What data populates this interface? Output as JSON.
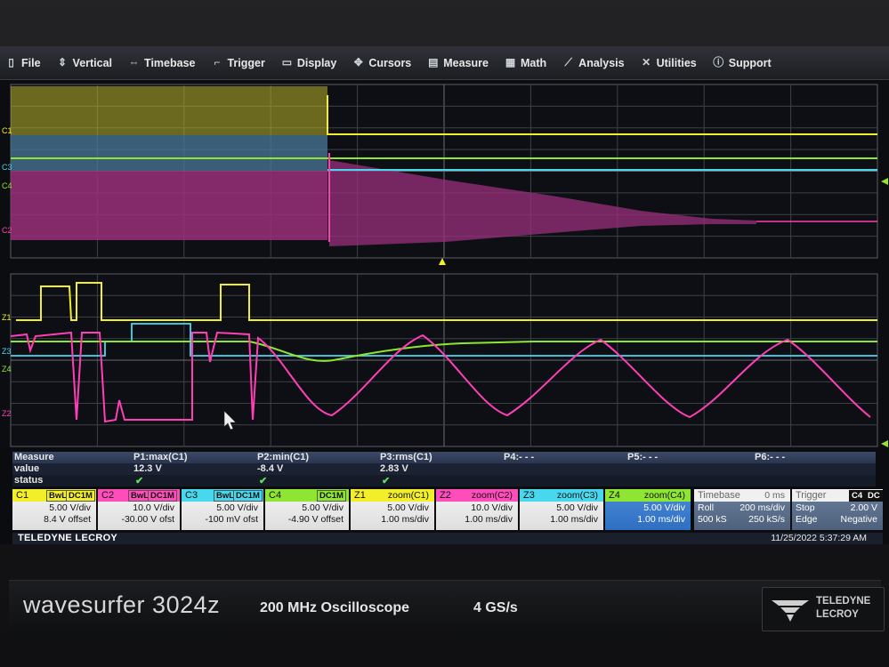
{
  "menu": [
    {
      "label": "File",
      "icon": "file-icon"
    },
    {
      "label": "Vertical",
      "icon": "vertical-icon"
    },
    {
      "label": "Timebase",
      "icon": "timebase-icon"
    },
    {
      "label": "Trigger",
      "icon": "trigger-icon"
    },
    {
      "label": "Display",
      "icon": "display-icon"
    },
    {
      "label": "Cursors",
      "icon": "cursors-icon"
    },
    {
      "label": "Measure",
      "icon": "measure-icon"
    },
    {
      "label": "Math",
      "icon": "math-icon"
    },
    {
      "label": "Analysis",
      "icon": "analysis-icon"
    },
    {
      "label": "Utilities",
      "icon": "utilities-icon"
    },
    {
      "label": "Support",
      "icon": "support-icon"
    }
  ],
  "upper_grid": {
    "labels": {
      "c1": "C1",
      "c3": "C3",
      "c4": "C4",
      "c2": "C2"
    }
  },
  "lower_grid": {
    "labels": {
      "z1": "Z1",
      "z3": "Z3",
      "z4": "Z4",
      "z2": "Z2"
    }
  },
  "measure": {
    "header_label": "Measure",
    "value_label": "value",
    "status_label": "status",
    "p1_name": "P1:max(C1)",
    "p2_name": "P2:min(C1)",
    "p3_name": "P3:rms(C1)",
    "p4_name": "P4:- - -",
    "p5_name": "P5:- - -",
    "p6_name": "P6:- - -",
    "p1_value": "12.3 V",
    "p2_value": "-8.4 V",
    "p3_value": "2.83 V",
    "status_check": "✔"
  },
  "channels": {
    "c1": {
      "label": "C1",
      "bwl": "BwL",
      "coupling": "DC1M",
      "scale": "5.00 V/div",
      "offset": "8.4 V offset"
    },
    "c2": {
      "label": "C2",
      "bwl": "BwL",
      "coupling": "DC1M",
      "scale": "10.0 V/div",
      "offset": "-30.00 V ofst"
    },
    "c3": {
      "label": "C3",
      "bwl": "BwL",
      "coupling": "DC1M",
      "scale": "5.00 V/div",
      "offset": "-100 mV ofst"
    },
    "c4": {
      "label": "C4",
      "coupling": "DC1M",
      "scale": "5.00 V/div",
      "offset": "-4.90 V offset"
    },
    "z1": {
      "label": "Z1",
      "source": "zoom(C1)",
      "scale": "5.00 V/div",
      "time": "1.00 ms/div"
    },
    "z2": {
      "label": "Z2",
      "source": "zoom(C2)",
      "scale": "10.0 V/div",
      "time": "1.00 ms/div"
    },
    "z3": {
      "label": "Z3",
      "source": "zoom(C3)",
      "scale": "5.00 V/div",
      "time": "1.00 ms/div"
    },
    "z4": {
      "label": "Z4",
      "source": "zoom(C4)",
      "scale": "5.00 V/div",
      "time": "1.00 ms/div"
    }
  },
  "timebase": {
    "label": "Timebase",
    "delay": "0 ms",
    "mode": "Roll",
    "rate": "200 ms/div",
    "samples": "500 kS",
    "srate": "250 kS/s"
  },
  "trigger": {
    "label": "Trigger",
    "tag_ch": "C4",
    "tag_cpl": "DC",
    "mode": "Stop",
    "level": "2.00 V",
    "type": "Edge",
    "slope": "Negative"
  },
  "status_bar": {
    "brand": "TELEDYNE LECROY",
    "datetime": "11/25/2022 5:37:29 AM"
  },
  "bezel": {
    "model": "wavesurfer 3024z",
    "spec_bw": "200 MHz Oscilloscope",
    "spec_sr": "4 GS/s",
    "logo_line1": "TELEDYNE",
    "logo_line2": "LECROY"
  },
  "colors": {
    "c1": "#f2ee2a",
    "c2": "#ff3fb5",
    "c3": "#47d8ee",
    "c4": "#8fe632",
    "grid": "#3e4048",
    "timebase_box": "#9eb4cf"
  }
}
